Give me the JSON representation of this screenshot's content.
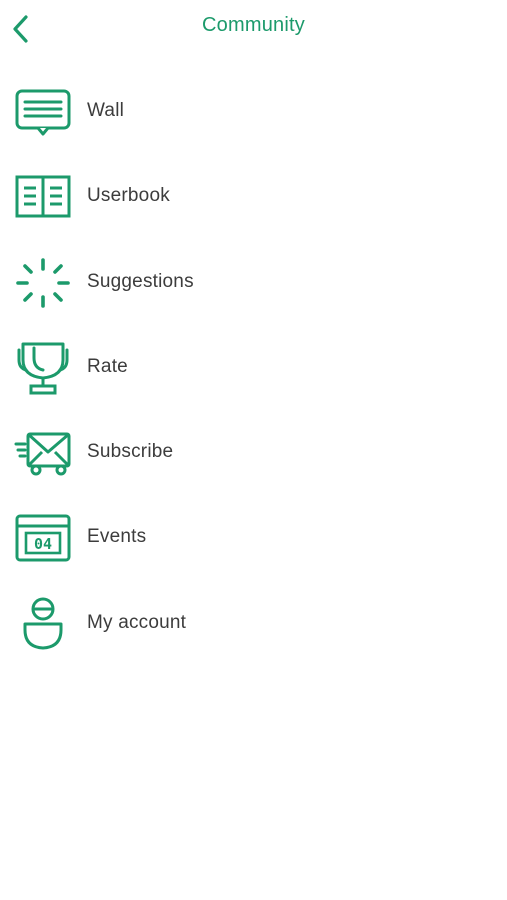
{
  "app": {
    "title": "Community",
    "accent_color": "#1c9a6b",
    "text_color": "#3c3c3c"
  },
  "header": {
    "back_icon": "chevron-left-icon",
    "title": "Community"
  },
  "menu": {
    "items": [
      {
        "label": "Wall",
        "icon": "message-board-icon"
      },
      {
        "label": "Userbook",
        "icon": "open-book-icon"
      },
      {
        "label": "Suggestions",
        "icon": "loading-spinner-icon"
      },
      {
        "label": "Rate",
        "icon": "trophy-icon"
      },
      {
        "label": "Subscribe",
        "icon": "envelope-delivery-icon"
      },
      {
        "label": "Events",
        "icon": "calendar-icon",
        "icon_text": "04"
      },
      {
        "label": "My account",
        "icon": "user-icon"
      }
    ]
  }
}
